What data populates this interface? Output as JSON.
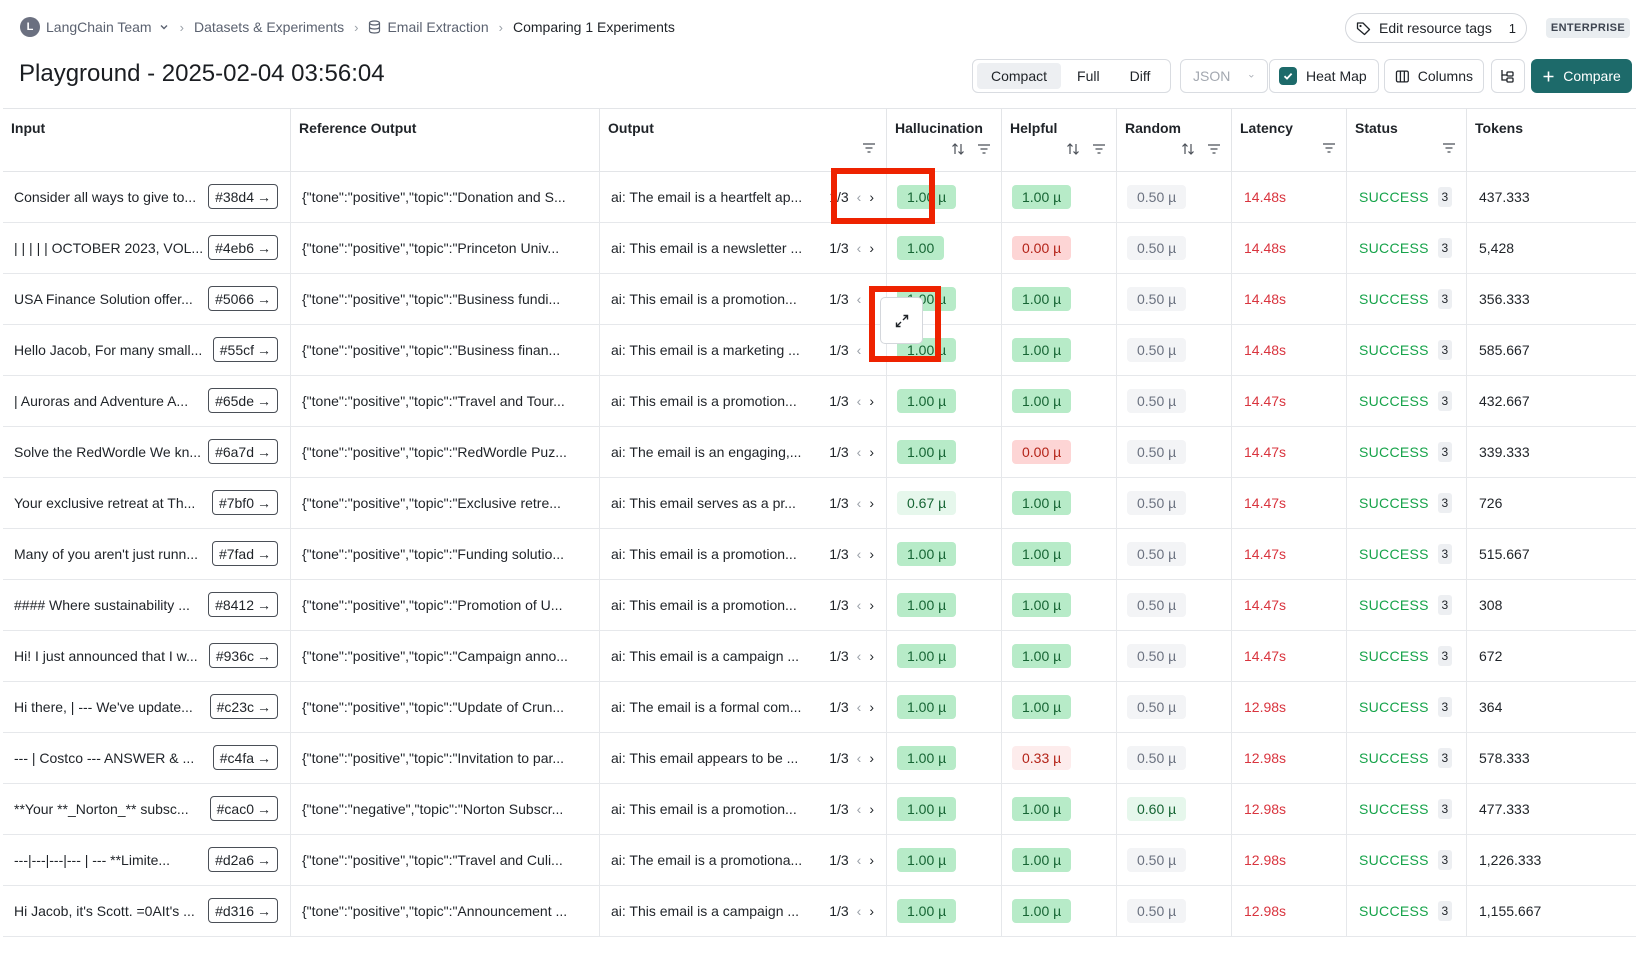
{
  "breadcrumb": {
    "workspace_initial": "L",
    "workspace": "LangChain Team",
    "section": "Datasets & Experiments",
    "dataset": "Email Extraction",
    "current": "Comparing 1 Experiments"
  },
  "header_actions": {
    "edit_tags_label": "Edit resource tags",
    "edit_tags_count": "1",
    "plan_badge": "ENTERPRISE"
  },
  "page": {
    "title": "Playground - 2025-02-04 03:56:04"
  },
  "toolbar": {
    "view_modes": [
      "Compact",
      "Full",
      "Diff"
    ],
    "active_view": "Compact",
    "format_select": "JSON",
    "heatmap_label": "Heat Map",
    "heatmap_checked": true,
    "columns_label": "Columns",
    "compare_label": "Compare",
    "accent_color": "#1d6a6a"
  },
  "columns": [
    "Input",
    "Reference Output",
    "Output",
    "Hallucination",
    "Helpful",
    "Random",
    "Latency",
    "Status",
    "Tokens"
  ],
  "rows": [
    {
      "input": "Consider all ways to give to...",
      "id": "#38d4",
      "reference": "{\"tone\":\"positive\",\"topic\":\"Donation and S...",
      "output": "ai: The email is a heartfelt ap...",
      "page": "1/3",
      "hallucination": "1.00 µ",
      "helpful": "1.00 µ",
      "random": "0.50 µ",
      "latency": "14.48s",
      "status": "SUCCESS",
      "status_count": "3",
      "tokens": "437.333"
    },
    {
      "input": "| | | | | OCTOBER 2023, VOL...",
      "id": "#4eb6",
      "reference": "{\"tone\":\"positive\",\"topic\":\"Princeton Univ...",
      "output": "ai: This email is a newsletter ...",
      "page": "1/3",
      "hallucination": "1.00",
      "helpful": "0.00 µ",
      "random": "0.50 µ",
      "latency": "14.48s",
      "status": "SUCCESS",
      "status_count": "3",
      "tokens": "5,428"
    },
    {
      "input": "USA Finance Solution offer...",
      "id": "#5066",
      "reference": "{\"tone\":\"positive\",\"topic\":\"Business fundi...",
      "output": "ai: This email is a promotion...",
      "page": "1/3",
      "hallucination": "1.00 µ",
      "helpful": "1.00 µ",
      "random": "0.50 µ",
      "latency": "14.48s",
      "status": "SUCCESS",
      "status_count": "3",
      "tokens": "356.333"
    },
    {
      "input": "Hello Jacob, For many small...",
      "id": "#55cf",
      "reference": "{\"tone\":\"positive\",\"topic\":\"Business finan...",
      "output": "ai: This email is a marketing ...",
      "page": "1/3",
      "hallucination": "1.00 µ",
      "helpful": "1.00 µ",
      "random": "0.50 µ",
      "latency": "14.48s",
      "status": "SUCCESS",
      "status_count": "3",
      "tokens": "585.667"
    },
    {
      "input": "| Auroras and Adventure A...",
      "id": "#65de",
      "reference": "{\"tone\":\"positive\",\"topic\":\"Travel and Tour...",
      "output": "ai: This email is a promotion...",
      "page": "1/3",
      "hallucination": "1.00 µ",
      "helpful": "1.00 µ",
      "random": "0.50 µ",
      "latency": "14.47s",
      "status": "SUCCESS",
      "status_count": "3",
      "tokens": "432.667"
    },
    {
      "input": "Solve the RedWordle We kn...",
      "id": "#6a7d",
      "reference": "{\"tone\":\"positive\",\"topic\":\"RedWordle Puz...",
      "output": "ai: The email is an engaging,...",
      "page": "1/3",
      "hallucination": "1.00 µ",
      "helpful": "0.00 µ",
      "random": "0.50 µ",
      "latency": "14.47s",
      "status": "SUCCESS",
      "status_count": "3",
      "tokens": "339.333"
    },
    {
      "input": "Your exclusive retreat at Th...",
      "id": "#7bf0",
      "reference": "{\"tone\":\"positive\",\"topic\":\"Exclusive retre...",
      "output": "ai: This email serves as a pr...",
      "page": "1/3",
      "hallucination": "0.67 µ",
      "helpful": "1.00 µ",
      "random": "0.50 µ",
      "latency": "14.47s",
      "status": "SUCCESS",
      "status_count": "3",
      "tokens": "726"
    },
    {
      "input": "Many of you aren't just runn...",
      "id": "#7fad",
      "reference": "{\"tone\":\"positive\",\"topic\":\"Funding solutio...",
      "output": "ai: This email is a promotion...",
      "page": "1/3",
      "hallucination": "1.00 µ",
      "helpful": "1.00 µ",
      "random": "0.50 µ",
      "latency": "14.47s",
      "status": "SUCCESS",
      "status_count": "3",
      "tokens": "515.667"
    },
    {
      "input": "#### Where sustainability ...",
      "id": "#8412",
      "reference": "{\"tone\":\"positive\",\"topic\":\"Promotion of U...",
      "output": "ai: This email is a promotion...",
      "page": "1/3",
      "hallucination": "1.00 µ",
      "helpful": "1.00 µ",
      "random": "0.50 µ",
      "latency": "14.47s",
      "status": "SUCCESS",
      "status_count": "3",
      "tokens": "308"
    },
    {
      "input": "Hi! I just announced that I w...",
      "id": "#936c",
      "reference": "{\"tone\":\"positive\",\"topic\":\"Campaign anno...",
      "output": "ai: This email is a campaign ...",
      "page": "1/3",
      "hallucination": "1.00 µ",
      "helpful": "1.00 µ",
      "random": "0.50 µ",
      "latency": "14.47s",
      "status": "SUCCESS",
      "status_count": "3",
      "tokens": "672"
    },
    {
      "input": "Hi there, | --- We've update...",
      "id": "#c23c",
      "reference": "{\"tone\":\"positive\",\"topic\":\"Update of Crun...",
      "output": "ai: The email is a formal com...",
      "page": "1/3",
      "hallucination": "1.00 µ",
      "helpful": "1.00 µ",
      "random": "0.50 µ",
      "latency": "12.98s",
      "status": "SUCCESS",
      "status_count": "3",
      "tokens": "364"
    },
    {
      "input": "--- | Costco --- ANSWER & ...",
      "id": "#c4fa",
      "reference": "{\"tone\":\"positive\",\"topic\":\"Invitation to par...",
      "output": "ai: This email appears to be ...",
      "page": "1/3",
      "hallucination": "1.00 µ",
      "helpful": "0.33 µ",
      "random": "0.50 µ",
      "latency": "12.98s",
      "status": "SUCCESS",
      "status_count": "3",
      "tokens": "578.333"
    },
    {
      "input": "**Your **_Norton_** subsc...",
      "id": "#cac0",
      "reference": "{\"tone\":\"negative\",\"topic\":\"Norton Subscr...",
      "output": "ai: This email is a promotion...",
      "page": "1/3",
      "hallucination": "1.00 µ",
      "helpful": "1.00 µ",
      "random": "0.60 µ",
      "latency": "12.98s",
      "status": "SUCCESS",
      "status_count": "3",
      "tokens": "477.333"
    },
    {
      "input": "---|---|---|--- | --- **Limite...",
      "id": "#d2a6",
      "reference": "{\"tone\":\"positive\",\"topic\":\"Travel and Culi...",
      "output": "ai: The email is a promotiona...",
      "page": "1/3",
      "hallucination": "1.00 µ",
      "helpful": "1.00 µ",
      "random": "0.50 µ",
      "latency": "12.98s",
      "status": "SUCCESS",
      "status_count": "3",
      "tokens": "1,226.333"
    },
    {
      "input": "Hi Jacob, it's Scott. =0AIt's ...",
      "id": "#d316",
      "reference": "{\"tone\":\"positive\",\"topic\":\"Announcement ...",
      "output": "ai: This email is a campaign ...",
      "page": "1/3",
      "hallucination": "1.00 µ",
      "helpful": "1.00 µ",
      "random": "0.50 µ",
      "latency": "12.98s",
      "status": "SUCCESS",
      "status_count": "3",
      "tokens": "1,155.667"
    }
  ],
  "colors": {
    "score_high": "#b7ebc8",
    "score_mid": "#e6f7ec",
    "score_zero": "#fdd5d5",
    "score_low": "#fdecec",
    "score_neutral": "#f3f4f6",
    "latency_text": "#d9343e",
    "status_text": "#16a34a",
    "highlight": "#ee2200"
  },
  "icons": {
    "breadcrumb_separator": "chevron-right-icon",
    "dataset": "database-icon",
    "tags": "tag-icon",
    "sort": "sort-icon",
    "filter": "filter-icon",
    "expand": "expand-icon",
    "row_link": "arrow-right-icon"
  }
}
